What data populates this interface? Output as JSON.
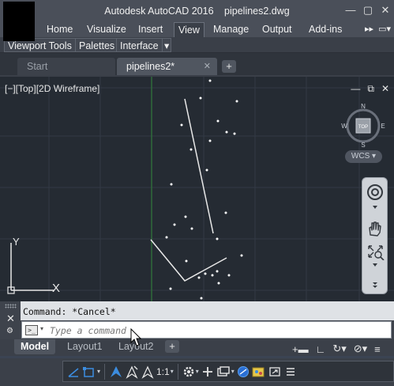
{
  "titlebar": {
    "app_name": "Autodesk AutoCAD 2016",
    "file_name": "pipelines2.dwg",
    "window_buttons": [
      "—",
      "▢",
      "✕"
    ]
  },
  "ribbon": {
    "tabs": [
      "Home",
      "Visualize",
      "Insert",
      "View",
      "Manage",
      "Output",
      "Add-ins"
    ],
    "active_tab": "View",
    "overflow": [
      "▸▸",
      "▭▾"
    ],
    "panels": [
      "Viewport Tools",
      "Palettes",
      "Interface",
      "▾"
    ]
  },
  "file_tabs": {
    "tabs": [
      {
        "label": "Start",
        "active": false,
        "close": ""
      },
      {
        "label": "pipelines2*",
        "active": true,
        "close": "✕"
      }
    ],
    "add": "+"
  },
  "viewport": {
    "label": "[−][Top][2D Wireframe]",
    "controls": [
      "—",
      "⧉",
      "✕"
    ],
    "viewcube": {
      "north": "N",
      "south": "S",
      "east": "E",
      "west": "W",
      "face": "TOP"
    },
    "wcs_label": "WCS ▾",
    "ucs": {
      "x": "X",
      "y": "Y"
    },
    "background": "#252b33"
  },
  "command_line": {
    "history": "Command: *Cancel*",
    "placeholder": "Type a command",
    "prompt_icon": ">_",
    "close": "✕",
    "wrench": "⚙",
    "dropdown": "▾"
  },
  "layout_tabs": {
    "tabs": [
      {
        "label": "Model",
        "active": true
      },
      {
        "label": "Layout1",
        "active": false
      },
      {
        "label": "Layout2",
        "active": false
      }
    ],
    "add": "+"
  },
  "status_bar": {
    "scale": "1:1",
    "annotation_scale_icon": "triangle-pointer",
    "top_icons": [
      "+▬",
      "∟",
      "↻▾",
      "⊘▾",
      "≡"
    ]
  }
}
